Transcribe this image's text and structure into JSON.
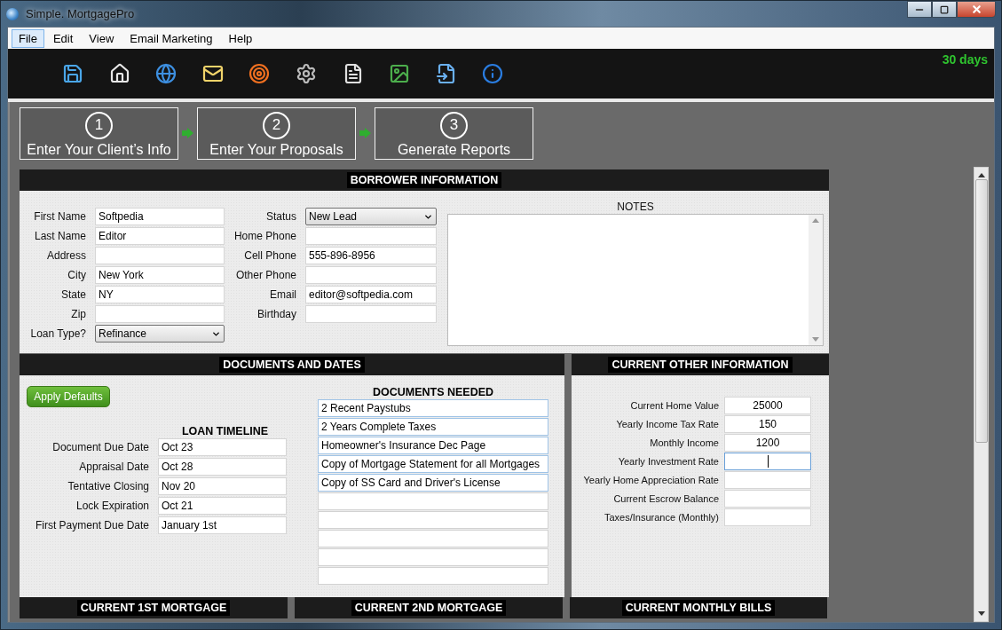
{
  "window": {
    "title": "Simple. MortgagePro"
  },
  "menu": [
    {
      "label": "File",
      "selected": true
    },
    {
      "label": "Edit",
      "selected": false
    },
    {
      "label": "View",
      "selected": false
    },
    {
      "label": "Email Marketing",
      "selected": false
    },
    {
      "label": "Help",
      "selected": false
    }
  ],
  "trial": "30 days",
  "steps": [
    {
      "number": "1",
      "label": "Enter Your Client’s Info"
    },
    {
      "number": "2",
      "label": "Enter Your Proposals"
    },
    {
      "number": "3",
      "label": "Generate Reports"
    }
  ],
  "borrower": {
    "title": "BORROWER INFORMATION",
    "left_fields": [
      {
        "label": "First Name",
        "value": "Softpedia",
        "kind": "text"
      },
      {
        "label": "Last Name",
        "value": "Editor",
        "kind": "text"
      },
      {
        "label": "Address",
        "kind": "text"
      },
      {
        "label": "City",
        "value": "New York",
        "kind": "text"
      },
      {
        "label": "State",
        "value": "NY",
        "kind": "text"
      },
      {
        "label": "Zip",
        "kind": "text"
      },
      {
        "label": "Loan Type?",
        "value": "Refinance",
        "kind": "dropdown"
      }
    ],
    "right_fields": [
      {
        "label": "Status",
        "value": "New Lead",
        "kind": "dropdown"
      },
      {
        "label": "Home Phone",
        "kind": "text"
      },
      {
        "label": "Cell Phone",
        "value": "555-896-8956",
        "kind": "text"
      },
      {
        "label": "Other Phone",
        "kind": "text"
      },
      {
        "label": "Email",
        "value": "editor@softpedia.com",
        "kind": "text"
      },
      {
        "label": "Birthday",
        "kind": "text"
      }
    ],
    "notes_label": "NOTES"
  },
  "documents": {
    "title": "DOCUMENTS AND DATES",
    "button": "Apply Defaults",
    "timeline_title": "LOAN TIMELINE",
    "timeline": [
      {
        "label": "Document Due Date",
        "value": "Oct 23"
      },
      {
        "label": "Appraisal Date",
        "value": "Oct 28"
      },
      {
        "label": "Tentative Closing",
        "value": "Nov 20"
      },
      {
        "label": "Lock Expiration",
        "value": "Oct 21"
      },
      {
        "label": "First Payment Due Date",
        "value": "January 1st"
      }
    ],
    "needed_title": "DOCUMENTS NEEDED",
    "needed": [
      {
        "value": "2 Recent Paystubs",
        "filled": true
      },
      {
        "value": "2 Years Complete Taxes",
        "filled": true
      },
      {
        "value": "Homeowner's Insurance Dec Page",
        "filled": true
      },
      {
        "value": "Copy of Mortgage Statement for all Mortgages",
        "filled": true
      },
      {
        "value": "Copy of SS Card and Driver's License",
        "filled": true
      },
      {
        "filled": false
      },
      {
        "filled": false
      },
      {
        "filled": false
      },
      {
        "filled": false
      },
      {
        "filled": false
      }
    ]
  },
  "other_info": {
    "title": "CURRENT OTHER INFORMATION",
    "fields": [
      {
        "label": "Current Home Value",
        "value": "25000",
        "focused": false
      },
      {
        "label": "Yearly Income Tax Rate",
        "value": "150",
        "focused": false
      },
      {
        "label": "Monthly Income",
        "value": "1200",
        "focused": false
      },
      {
        "label": "Yearly Investment Rate",
        "focused": true
      },
      {
        "label": "Yearly Home Appreciation Rate",
        "focused": false
      },
      {
        "label": "Current Escrow Balance",
        "focused": false
      },
      {
        "label": "Taxes/Insurance (Monthly)",
        "focused": false
      }
    ]
  },
  "bottom_sections": [
    "CURRENT 1ST MORTGAGE",
    "CURRENT 2ND MORTGAGE",
    "CURRENT MONTHLY BILLS"
  ]
}
